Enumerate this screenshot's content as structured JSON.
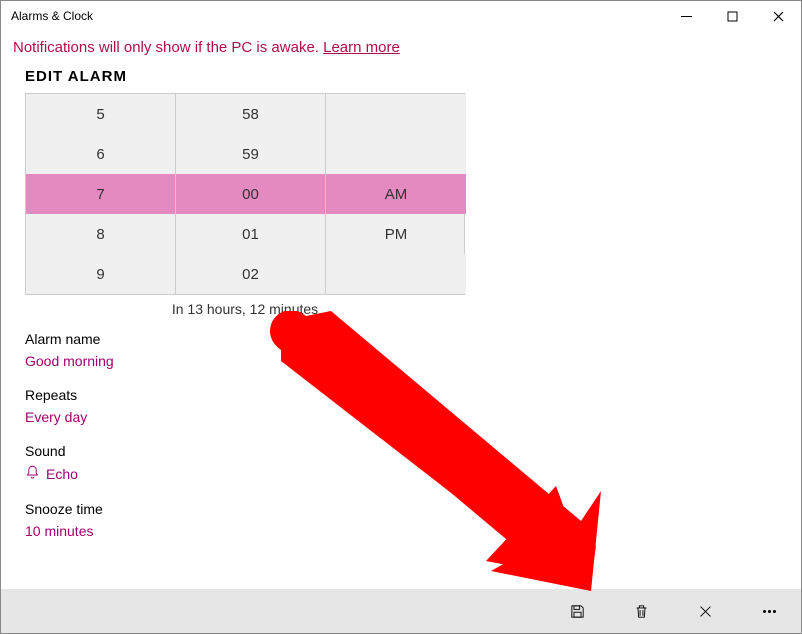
{
  "window": {
    "title": "Alarms & Clock"
  },
  "notification": {
    "text": "Notifications will only show if the PC is awake. ",
    "link": "Learn more"
  },
  "page": {
    "title": "EDIT ALARM",
    "countdown": "In 13 hours, 12 minutes"
  },
  "picker": {
    "hours": [
      "5",
      "6",
      "7",
      "8",
      "9"
    ],
    "minutes": [
      "58",
      "59",
      "00",
      "01",
      "02"
    ],
    "ampm": [
      "",
      "",
      "AM",
      "PM",
      ""
    ]
  },
  "fields": {
    "alarmName": {
      "label": "Alarm name",
      "value": "Good morning"
    },
    "repeats": {
      "label": "Repeats",
      "value": "Every day"
    },
    "sound": {
      "label": "Sound",
      "value": "Echo"
    },
    "snooze": {
      "label": "Snooze time",
      "value": "10 minutes"
    }
  },
  "colors": {
    "accent": "#a0006e",
    "highlight": "#e58ac1",
    "notification": "#b10e46"
  }
}
